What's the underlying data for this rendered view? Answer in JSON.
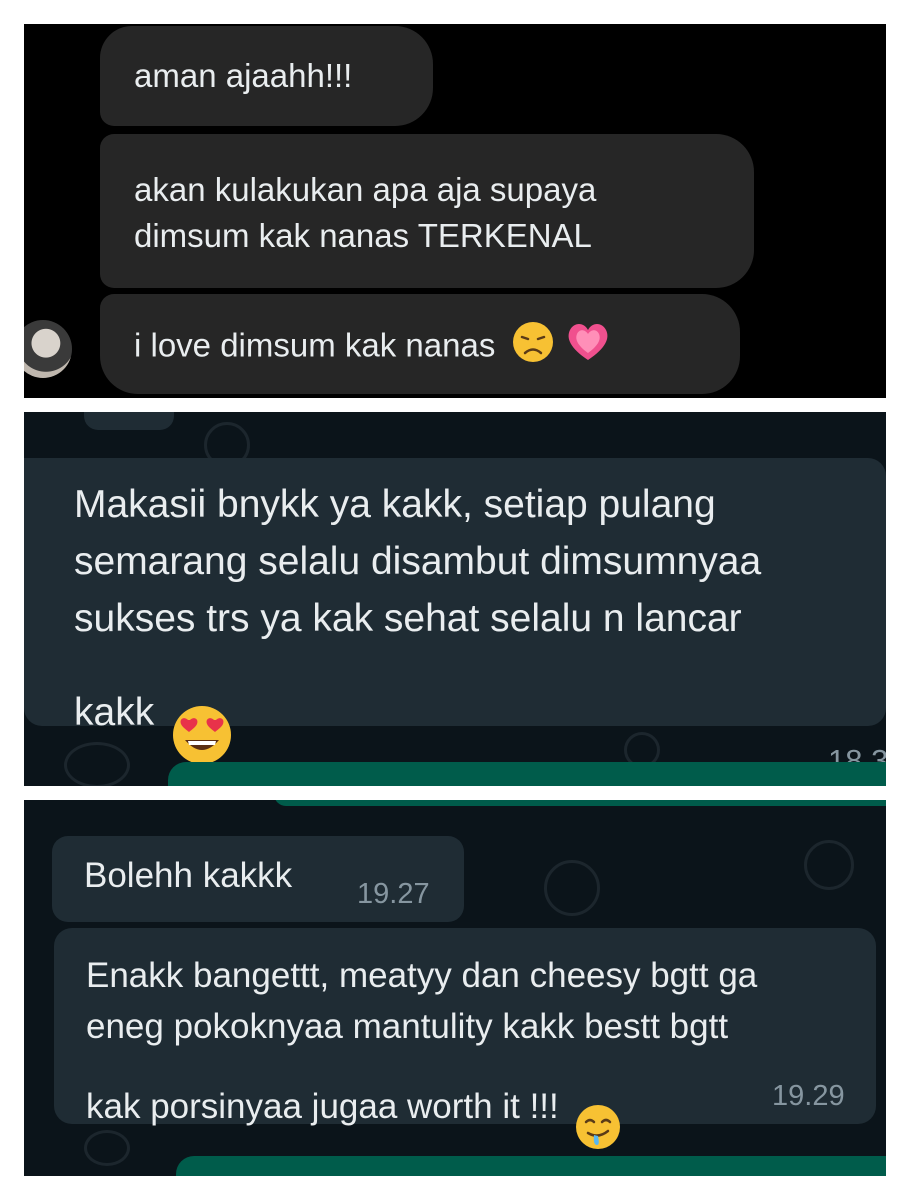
{
  "panel1": {
    "messages": [
      {
        "text": "aman ajaahh!!!"
      },
      {
        "text": "akan kulakukan apa aja supaya\ndimsum kak nanas TERKENAL"
      },
      {
        "text": "i love dimsum kak nanas",
        "emojis": [
          "disappointed-face",
          "growing-heart"
        ]
      }
    ]
  },
  "panel2": {
    "message": {
      "text": "Makasii bnykk ya kakk, setiap pulang\nsemarang selalu disambut dimsumnyaa\nsukses trs ya kak sehat selalu n lancar\nkakk",
      "emoji": "heart-eyes-face",
      "time": "18.3"
    }
  },
  "panel3": {
    "messages": [
      {
        "text": "Bolehh kakkk",
        "time": "19.27"
      },
      {
        "text": "Enakk bangettt, meatyy dan cheesy bgtt ga\neneg pokoknyaa mantulity kakk bestt bgtt\nkak porsinyaa jugaa worth it !!!",
        "emoji": "drooling-face",
        "time": "19.29"
      }
    ]
  },
  "colors": {
    "incoming_bubble": "#1f2c34",
    "outgoing_bubble": "#005c4b",
    "chat_background": "#0b141a",
    "timestamp": "#8696a0"
  }
}
